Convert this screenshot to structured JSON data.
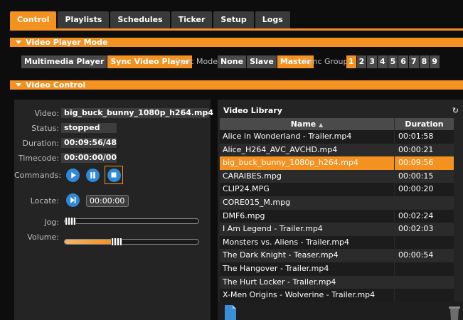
{
  "tabs": [
    "Control",
    "Playlists",
    "Schedules",
    "Ticker",
    "Setup",
    "Logs"
  ],
  "sections": {
    "mode": "Video Player Mode",
    "control": "Video Control"
  },
  "mode": {
    "multimedia": "Multimedia Player",
    "sync": "Sync Video Player",
    "sync_mode_label": "Sync Mode:",
    "sync_modes": [
      "None",
      "Slave",
      "Master"
    ],
    "sync_group_label": "Sync Group:",
    "groups": [
      "1",
      "2",
      "3",
      "4",
      "5",
      "6",
      "7",
      "8",
      "9"
    ]
  },
  "control": {
    "video_label": "Video:",
    "video": "big_buck_bunny_1080p_h264.mp4",
    "status_label": "Status:",
    "status": "stopped",
    "duration_label": "Duration:",
    "duration": "00:09:56/48",
    "timecode_label": "Timecode:",
    "timecode": "00:00:00/00",
    "commands_label": "Commands:",
    "locate_label": "Locate:",
    "locate": "00:00:00",
    "jog_label": "Jog:",
    "volume_label": "Volume:"
  },
  "library": {
    "title": "Video Library",
    "col_name": "Name",
    "col_duration": "Duration",
    "rows": [
      {
        "name": "Alice in Wonderland - Trailer.mp4",
        "duration": "00:01:58"
      },
      {
        "name": "Alice_H264_AVC_AVCHD.mp4",
        "duration": "00:00:21"
      },
      {
        "name": "big_buck_bunny_1080p_h264.mp4",
        "duration": "00:09:56"
      },
      {
        "name": "CARAIBES.mpg",
        "duration": "00:00:15"
      },
      {
        "name": "CLIP24.MPG",
        "duration": "00:00:20"
      },
      {
        "name": "CORE015_M.mpg",
        "duration": ""
      },
      {
        "name": "DMF6.mpg",
        "duration": "00:02:24"
      },
      {
        "name": "I Am Legend - Trailer.mp4",
        "duration": "00:02:03"
      },
      {
        "name": "Monsters vs. Aliens - Trailer.mp4",
        "duration": ""
      },
      {
        "name": "The Dark Knight - Teaser.mp4",
        "duration": "00:00:54"
      },
      {
        "name": "The Hangover - Trailer.mp4",
        "duration": ""
      },
      {
        "name": "The Hurt Locker - Trailer.mp4",
        "duration": ""
      },
      {
        "name": "X-Men Origins - Wolverine - Trailer.mp4",
        "duration": ""
      }
    ]
  },
  "colors": {
    "accent": "#f39221",
    "blue": "#2f88d8",
    "bg": "#0d0d0d"
  }
}
